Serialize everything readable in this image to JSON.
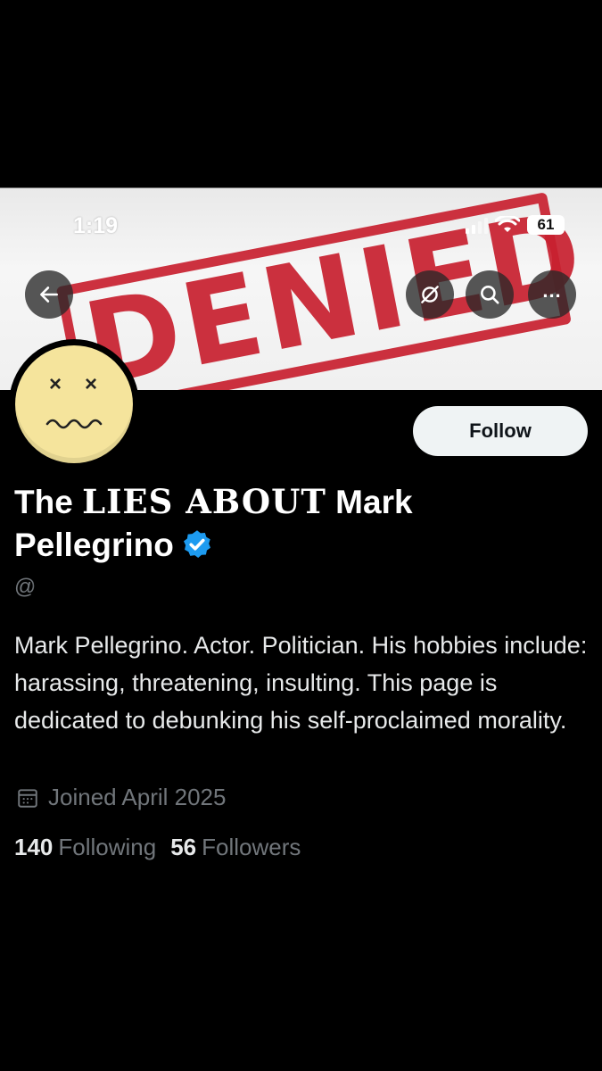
{
  "status_bar": {
    "time": "1:19",
    "battery": "61"
  },
  "banner": {
    "stamp_text": "DENIED"
  },
  "toolbar": {
    "more_glyph": "..."
  },
  "profile": {
    "follow_label": "Follow",
    "name_part1": "The ",
    "name_part2": "LIES ABOUT",
    "name_part3": " Mark Pellegrino",
    "handle": "@",
    "bio": "Mark Pellegrino. Actor. Politician. His hobbies include: harassing, threatening, insulting. This page is dedicated to debunking his self-proclaimed morality.",
    "joined": "Joined April 2025",
    "following_count": "140",
    "following_label": "Following",
    "followers_count": "56",
    "followers_label": "Followers"
  },
  "colors": {
    "accent_verified": "#1d9bf0",
    "stamp_red": "#c8202f",
    "muted_text": "#71767b"
  }
}
